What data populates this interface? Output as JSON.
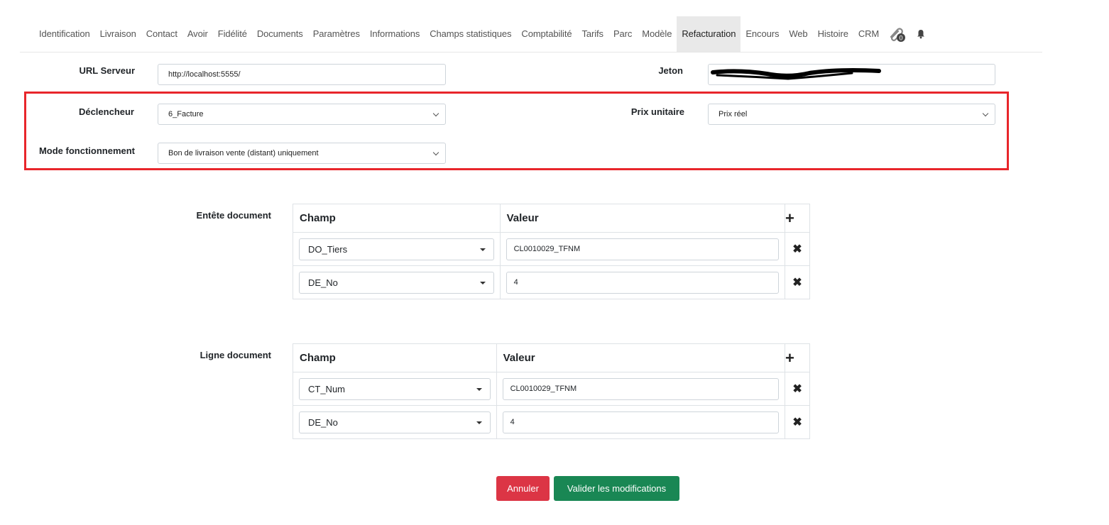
{
  "tabs": [
    {
      "label": "Identification"
    },
    {
      "label": "Livraison"
    },
    {
      "label": "Contact"
    },
    {
      "label": "Avoir"
    },
    {
      "label": "Fidélité"
    },
    {
      "label": "Documents"
    },
    {
      "label": "Paramètres"
    },
    {
      "label": "Informations"
    },
    {
      "label": "Champs statistiques"
    },
    {
      "label": "Comptabilité"
    },
    {
      "label": "Tarifs"
    },
    {
      "label": "Parc"
    },
    {
      "label": "Modèle"
    },
    {
      "label": "Refacturation",
      "active": true
    },
    {
      "label": "Encours"
    },
    {
      "label": "Web"
    },
    {
      "label": "Histoire"
    },
    {
      "label": "CRM"
    }
  ],
  "attachments_badge": "0",
  "config": {
    "url_label": "URL Serveur",
    "url_value": "http://localhost:5555/",
    "jeton_label": "Jeton",
    "jeton_value": "",
    "declencheur_label": "Déclencheur",
    "declencheur_value": "6_Facture",
    "prix_label": "Prix unitaire",
    "prix_value": "Prix réel",
    "mode_label": "Mode fonctionnement",
    "mode_value": "Bon de livraison vente (distant) uniquement"
  },
  "entete": {
    "label": "Entête document",
    "col_champ": "Champ",
    "col_valeur": "Valeur",
    "rows": [
      {
        "champ": "DO_Tiers",
        "valeur": "CL0010029_TFNM"
      },
      {
        "champ": "DE_No",
        "valeur": "4"
      }
    ]
  },
  "ligne": {
    "label": "Ligne document",
    "col_champ": "Champ",
    "col_valeur": "Valeur",
    "rows": [
      {
        "champ": "CT_Num",
        "valeur": "CL0010029_TFNM"
      },
      {
        "champ": "DE_No",
        "valeur": "4"
      }
    ]
  },
  "buttons": {
    "cancel": "Annuler",
    "save": "Valider les modifications"
  },
  "colors": {
    "highlight": "#e8262b",
    "cancel": "#dc3545",
    "save": "#198754"
  }
}
